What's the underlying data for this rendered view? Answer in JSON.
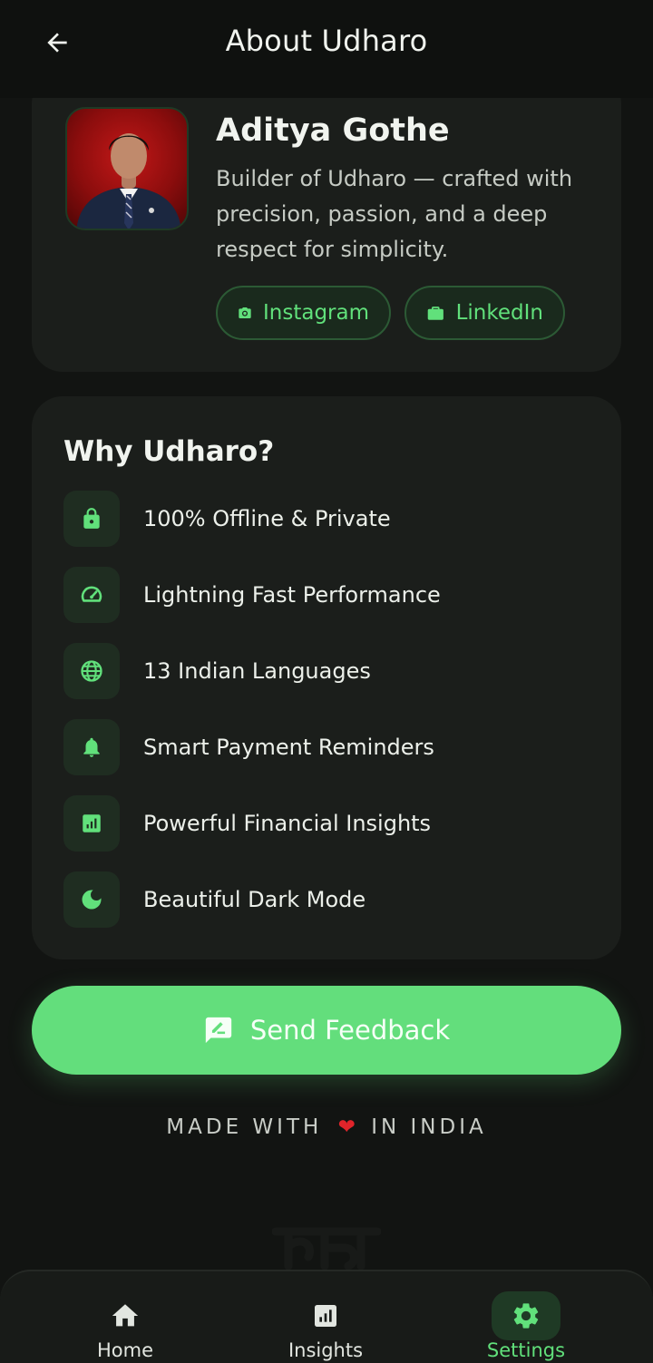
{
  "header": {
    "title": "About Udharo",
    "back_icon": "arrow-back-icon"
  },
  "profile": {
    "name": "Aditya Gothe",
    "bio": "Builder of Udharo — crafted with precision, passion, and a deep respect for simplicity.",
    "links": [
      {
        "label": "Instagram",
        "icon": "camera-icon"
      },
      {
        "label": "LinkedIn",
        "icon": "briefcase-icon"
      }
    ]
  },
  "why": {
    "title": "Why Udharo?",
    "features": [
      {
        "label": "100% Offline & Private",
        "icon": "lock-icon"
      },
      {
        "label": "Lightning Fast Performance",
        "icon": "speedometer-icon"
      },
      {
        "label": "13 Indian Languages",
        "icon": "globe-icon"
      },
      {
        "label": "Smart Payment Reminders",
        "icon": "bell-icon"
      },
      {
        "label": "Powerful Financial Insights",
        "icon": "bar-chart-icon"
      },
      {
        "label": "Beautiful Dark Mode",
        "icon": "moon-icon"
      }
    ]
  },
  "feedback": {
    "label": "Send Feedback",
    "icon": "feedback-icon"
  },
  "footer": {
    "made_with_prefix": "MADE WITH",
    "made_with_suffix": "IN INDIA",
    "heart": "❤"
  },
  "nav": {
    "items": [
      {
        "label": "Home",
        "icon": "home-icon"
      },
      {
        "label": "Insights",
        "icon": "insights-icon"
      },
      {
        "label": "Settings",
        "icon": "gear-icon",
        "active": true
      }
    ]
  },
  "colors": {
    "accent": "#63de7c",
    "background": "#121412",
    "card": "#1b1e1b"
  }
}
